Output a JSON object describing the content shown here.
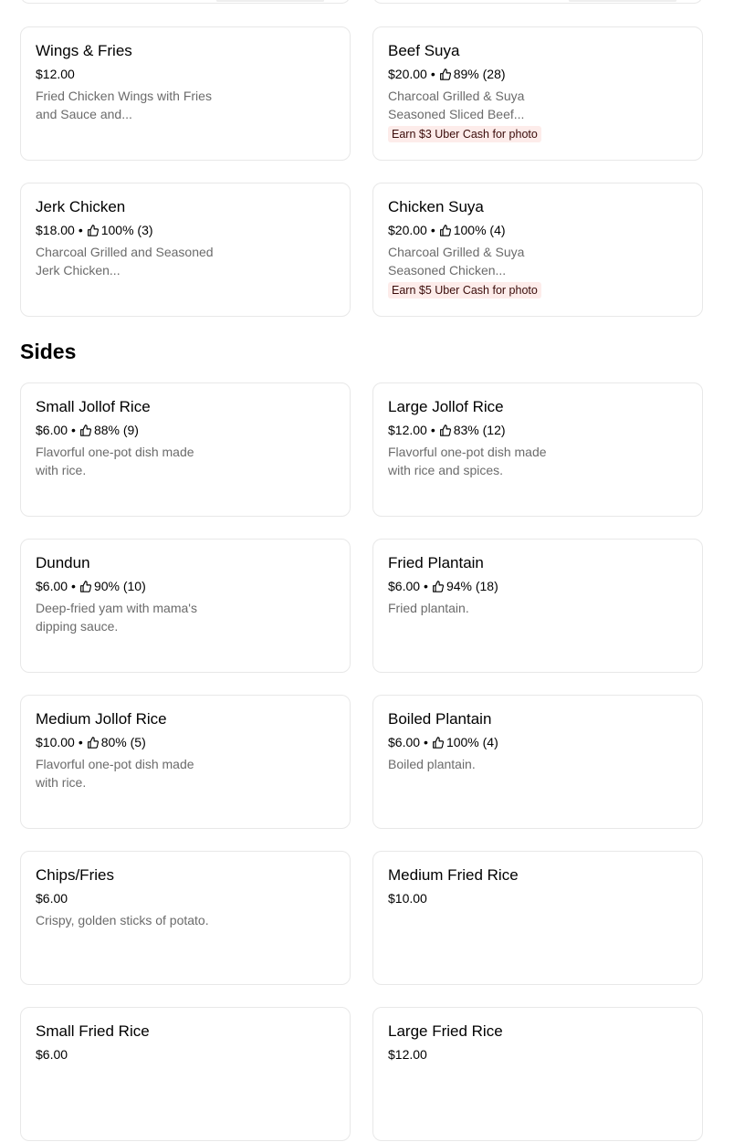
{
  "sections": [
    {
      "title": "",
      "items": [
        {
          "name": "Wings & Fries",
          "price": "$12.00",
          "rating": "",
          "description": "Fried Chicken Wings with Fries and Sauce and...",
          "promo": ""
        },
        {
          "name": "Beef Suya",
          "price": "$20.00",
          "rating": "89% (28)",
          "description": "Charcoal Grilled & Suya Seasoned Sliced Beef...",
          "promo": "Earn $3 Uber Cash for photo"
        },
        {
          "name": "Jerk Chicken",
          "price": "$18.00",
          "rating": "100% (3)",
          "description": "Charcoal Grilled and Seasoned Jerk Chicken...",
          "promo": ""
        },
        {
          "name": "Chicken Suya",
          "price": "$20.00",
          "rating": "100% (4)",
          "description": "Charcoal Grilled & Suya Seasoned Chicken...",
          "promo": "Earn $5 Uber Cash for photo"
        }
      ]
    },
    {
      "title": "Sides",
      "items": [
        {
          "name": "Small Jollof Rice",
          "price": "$6.00",
          "rating": "88% (9)",
          "description": "Flavorful one-pot dish made with rice.",
          "promo": ""
        },
        {
          "name": "Large Jollof Rice",
          "price": "$12.00",
          "rating": "83% (12)",
          "description": "Flavorful one-pot dish made with rice and spices.",
          "promo": ""
        },
        {
          "name": "Dundun",
          "price": "$6.00",
          "rating": "90% (10)",
          "description": "Deep-fried yam with mama's dipping sauce.",
          "promo": ""
        },
        {
          "name": "Fried Plantain",
          "price": "$6.00",
          "rating": "94% (18)",
          "description": "Fried plantain.",
          "promo": ""
        },
        {
          "name": "Medium Jollof Rice",
          "price": "$10.00",
          "rating": "80% (5)",
          "description": "Flavorful one-pot dish made with rice.",
          "promo": ""
        },
        {
          "name": "Boiled Plantain",
          "price": "$6.00",
          "rating": "100% (4)",
          "description": "Boiled plantain.",
          "promo": ""
        },
        {
          "name": "Chips/Fries",
          "price": "$6.00",
          "rating": "",
          "description": "Crispy, golden sticks of potato.",
          "promo": ""
        },
        {
          "name": "Medium Fried Rice",
          "price": "$10.00",
          "rating": "",
          "description": "",
          "promo": ""
        },
        {
          "name": "Small Fried Rice",
          "price": "$6.00",
          "rating": "",
          "description": "",
          "promo": ""
        },
        {
          "name": "Large Fried Rice",
          "price": "$12.00",
          "rating": "",
          "description": "",
          "promo": ""
        }
      ]
    }
  ],
  "separator": "•",
  "icons": {
    "rating": "thumbs-up-icon"
  },
  "colors": {
    "promo_background": "#fdecea",
    "promo_text": "#3a0c0a",
    "description_text": "#6b6b6b",
    "border": "#e8e8e8"
  }
}
